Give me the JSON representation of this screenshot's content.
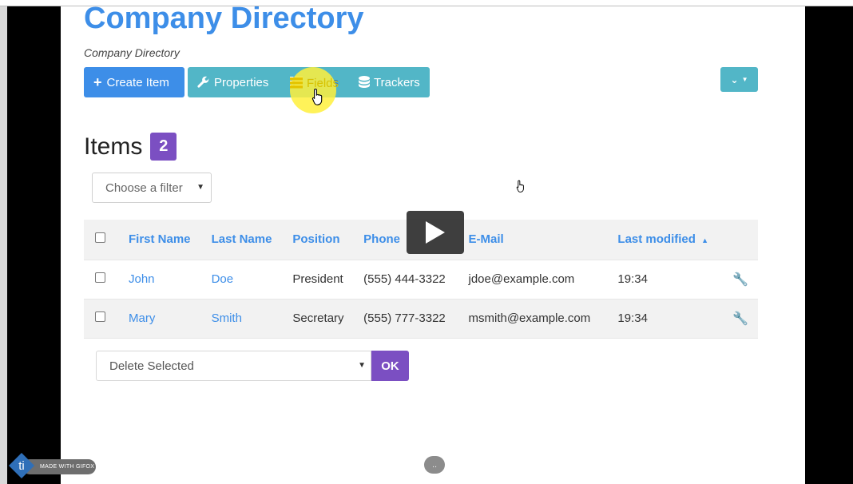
{
  "page": {
    "title": "Company Directory",
    "breadcrumb": "Company Directory"
  },
  "toolbar": {
    "create_label": "Create Item",
    "properties_label": "Properties",
    "fields_label": "Fields",
    "trackers_label": "Trackers"
  },
  "items": {
    "heading": "Items",
    "count": "2"
  },
  "filter": {
    "placeholder": "Choose a filter"
  },
  "table": {
    "columns": [
      "First Name",
      "Last Name",
      "Position",
      "Phone",
      "E-Mail",
      "Last modified"
    ],
    "rows": [
      {
        "first": "John",
        "last": "Doe",
        "position": "President",
        "phone": "(555) 444-3322",
        "email": "jdoe@example.com",
        "modified": "19:34"
      },
      {
        "first": "Mary",
        "last": "Smith",
        "position": "Secretary",
        "phone": "(555) 777-3322",
        "email": "msmith@example.com",
        "modified": "19:34"
      }
    ]
  },
  "bulk": {
    "action": "Delete Selected",
    "ok_label": "OK"
  },
  "overlay": {
    "watermark": "MADE WITH GIFOX",
    "more_label": "..",
    "logo_letters": "ti"
  },
  "colors": {
    "accent": "#3d8ee8",
    "info": "#52b6c7",
    "purple": "#7b4fc2",
    "highlight": "#fff03c"
  },
  "icons": [
    "plus-icon",
    "wrench-icon",
    "table-list-icon",
    "database-icon",
    "chevron-down-icon",
    "sort-up-icon",
    "play-icon"
  ]
}
